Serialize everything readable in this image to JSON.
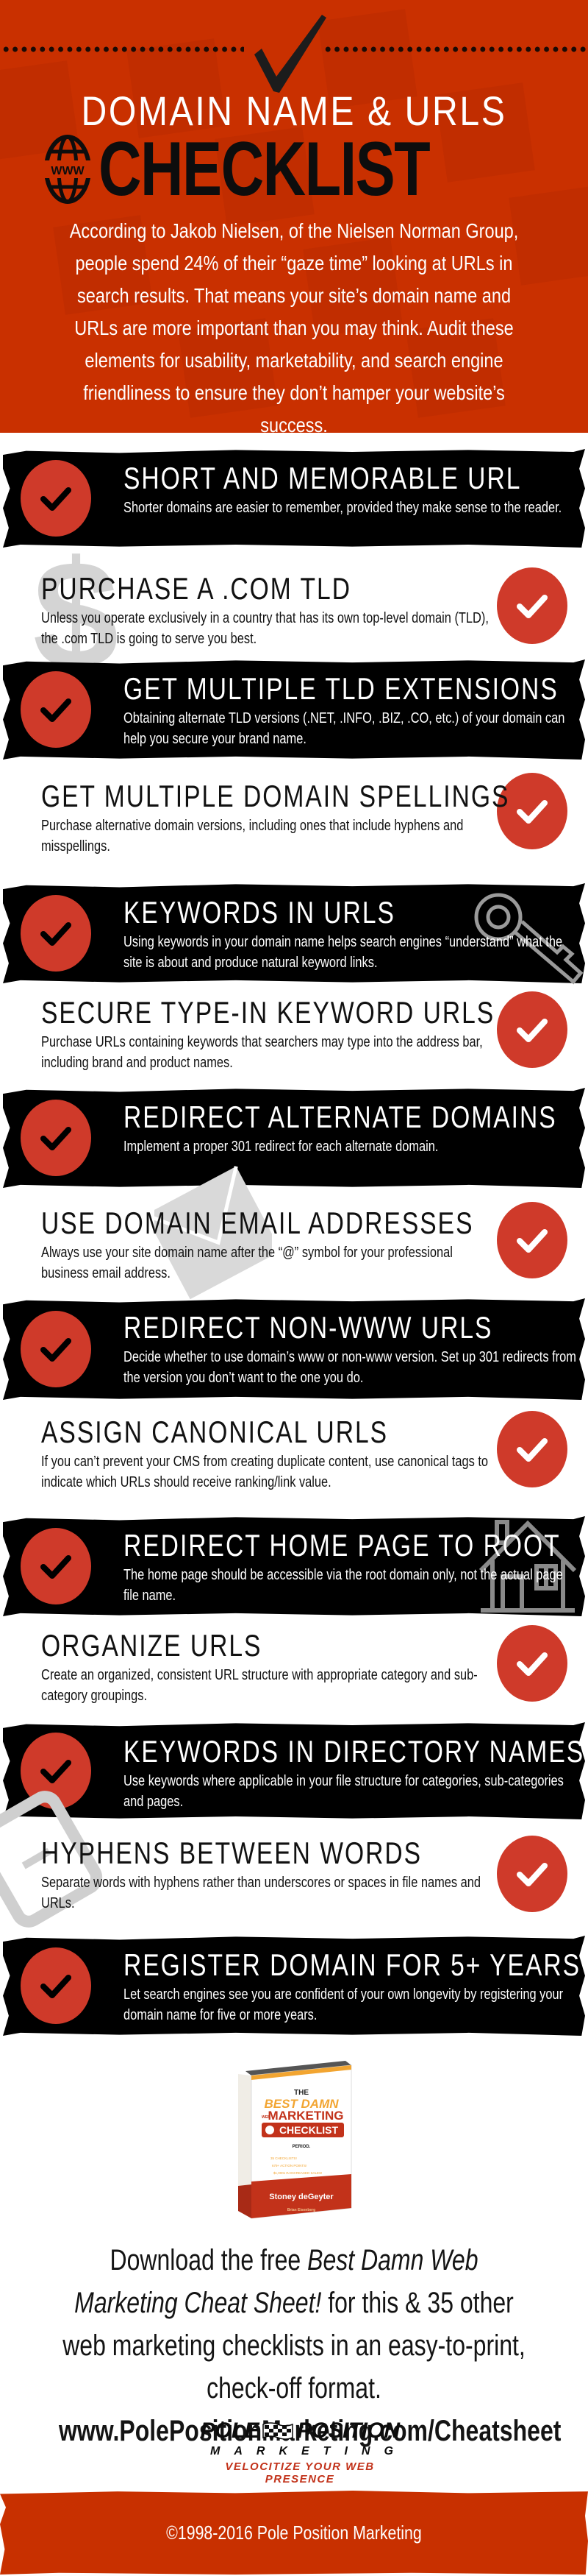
{
  "header": {
    "title_line1": "DOMAIN NAME & URLS",
    "title_line2": "CHECKLIST",
    "globe_label": "WWW",
    "intro": "According to Jakob Nielsen, of the Nielsen Norman Group, people spend 24% of their “gaze time” looking at URLs in search results. That means your site’s domain name and URLs are more important than you may think.  Audit these elements for usability, marketability, and search engine friendliness to ensure they don’t hamper your website’s success."
  },
  "items": [
    {
      "title": "SHORT AND MEMORABLE URL",
      "desc": "Shorter domains are easier to remember, provided they make sense to the reader.",
      "style": "dark",
      "watermark": null
    },
    {
      "title": "PURCHASE A .COM TLD",
      "desc": "Unless you operate exclusively in a country that has its own top-level domain (TLD), the .com TLD is going to serve you best.",
      "style": "light",
      "watermark": "dollar-icon"
    },
    {
      "title": "GET MULTIPLE TLD EXTENSIONS",
      "desc": "Obtaining alternate TLD versions (.NET, .INFO, .BIZ, .CO, etc.) of your domain can help you secure your brand name.",
      "style": "dark",
      "watermark": null
    },
    {
      "title": "GET MULTIPLE DOMAIN SPELLINGS",
      "desc": "Purchase alternative domain versions, including ones that include hyphens and misspellings.",
      "style": "light",
      "watermark": null
    },
    {
      "title": "KEYWORDS IN URLS",
      "desc": "Using keywords in your domain name helps search engines “understand” what the site is about and produce natural keyword links.",
      "style": "dark",
      "watermark": "key-icon"
    },
    {
      "title": "SECURE TYPE-IN KEYWORD URLS",
      "desc": "Purchase URLs containing keywords that searchers may type into the address bar, including brand and product names.",
      "style": "light",
      "watermark": null
    },
    {
      "title": "REDIRECT ALTERNATE DOMAINS",
      "desc": "Implement a proper 301 redirect for each alternate domain.",
      "style": "dark",
      "watermark": null
    },
    {
      "title": "USE DOMAIN EMAIL ADDRESSES",
      "desc": "Always use your site domain name after the “@” symbol for your professional business email address.",
      "style": "light",
      "watermark": "envelope-icon"
    },
    {
      "title": "REDIRECT NON-WWW URLS",
      "desc": "Decide whether to use domain’s www or non-www version. Set up 301 redirects from the version you don’t want to the one you do.",
      "style": "dark",
      "watermark": null
    },
    {
      "title": "ASSIGN CANONICAL URLS",
      "desc": "If you can’t prevent your CMS from creating duplicate content, use canonical tags to indicate which URLs should receive ranking/link value.",
      "style": "light",
      "watermark": null
    },
    {
      "title": "REDIRECT HOME PAGE TO ROOT",
      "desc": "The home page should be accessible via the root domain only, not the actual page file name.",
      "style": "dark",
      "watermark": "house-icon"
    },
    {
      "title": "ORGANIZE URLS",
      "desc": "Create an organized, consistent URL structure with appropriate category and sub-category groupings.",
      "style": "light",
      "watermark": null
    },
    {
      "title": "KEYWORDS IN DIRECTORY NAMES",
      "desc": "Use keywords where applicable in your file structure for categories, sub-categories and pages.",
      "style": "dark",
      "watermark": null
    },
    {
      "title": "HYPHENS BETWEEN WORDS",
      "desc": "Separate words with hyphens rather than underscores or spaces in file names and URLs.",
      "style": "light",
      "watermark": "hyphen-key-icon"
    },
    {
      "title": "REGISTER DOMAIN FOR 5+ YEARS",
      "desc": "Let search engines see you are confident of your own longevity by registering your domain name for five or more years.",
      "style": "dark",
      "watermark": null
    }
  ],
  "book": {
    "the": "THE",
    "line1": "BEST DAMN",
    "web": "WEB",
    "line2": "MARKETING",
    "line3": "CHECKLIST",
    "period": "PERIOD.",
    "bullets": [
      "35 CHECKLISTS!",
      "679+ ACTION POINTS!",
      "$1,000s IN INCREASED SALES!"
    ],
    "author": "Stoney deGeyter",
    "foreword": "Brian Eisenberg"
  },
  "cta": {
    "prefix": "Download the free ",
    "italic": "Best Damn Web Marketing Cheat Sheet!",
    "suffix": " for this & 35 other web marketing checklists in an easy-to-print, check-off format.",
    "url": "www.PolePositionMarketing.com/Cheatsheet"
  },
  "logo": {
    "word1": "POLE",
    "word2": "POSITION",
    "word3": "MARKETING",
    "tagline": "VELOCITIZE YOUR WEB PRESENCE"
  },
  "footer": {
    "copyright": "©1998-2016 Pole Position Marketing"
  },
  "colors": {
    "header_bg": "#c93000",
    "check_red": "#cf3a2a",
    "band_black": "#000000",
    "tagline_red": "#c2321a"
  }
}
